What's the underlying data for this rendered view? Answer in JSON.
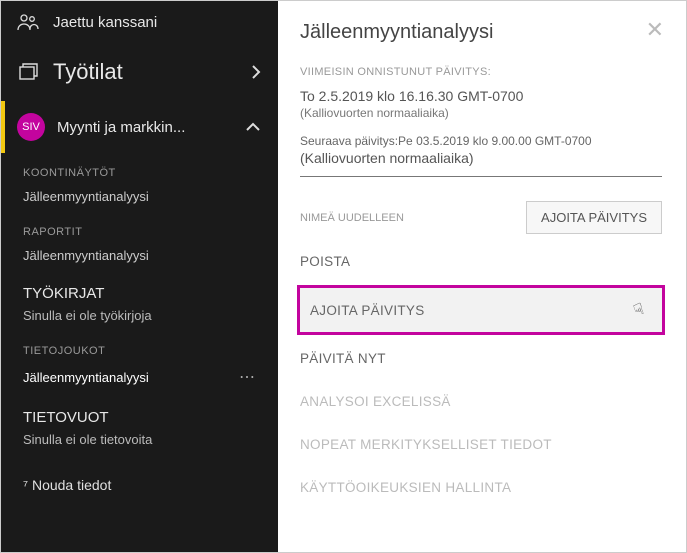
{
  "sidebar": {
    "shared_label": "Jaettu kanssani",
    "workspaces_label": "Työtilat",
    "current_workspace": "Myynti ja markkin...",
    "avatar_initials": "SIV",
    "sections": {
      "dashboards_label": "KOONTINÄYTÖT",
      "dashboards_item": "Jälleenmyyntianalyysi",
      "reports_label": "RAPORTIT",
      "reports_item": "Jälleenmyyntianalyysi",
      "workbooks_title": "TYÖKIRJAT",
      "workbooks_sub": "Sinulla ei ole työkirjoja",
      "datasets_label": "TIETOJOUKOT",
      "datasets_item": "Jälleenmyyntianalyysi",
      "dataflows_title": "TIETOVUOT",
      "dataflows_sub": "Sinulla ei ole tietovoita"
    },
    "footer": "⁷ Nouda tiedot"
  },
  "panel": {
    "title": "Jälleenmyyntianalyysi",
    "last_success_label": "VIIMEISIN ONNISTUNUT PÄIVITYS:",
    "last_success_value": "To 2.5.2019 klo 16.16.30 GMT-0700",
    "last_success_tz": "(Kalliovuorten normaaliaika)",
    "next_label": "Seuraava päivitys:Pe 03.5.2019 klo 9.00.00 GMT-0700",
    "next_tz": "(Kalliovuorten normaaliaika)",
    "rename_label": "NIMEÄ UUDELLEEN",
    "schedule_button": "AJOITA PÄIVITYS",
    "actions": {
      "delete": "POISTA",
      "schedule": "AJOITA PÄIVITYS",
      "refresh_now": "PÄIVITÄ NYT",
      "analyze_excel": "ANALYSOI EXCELISSÄ",
      "quick_insights": "NOPEAT MERKITYKSELLISET TIEDOT",
      "permissions": "KÄYTTÖOIKEUKSIEN  HALLINTA"
    }
  }
}
